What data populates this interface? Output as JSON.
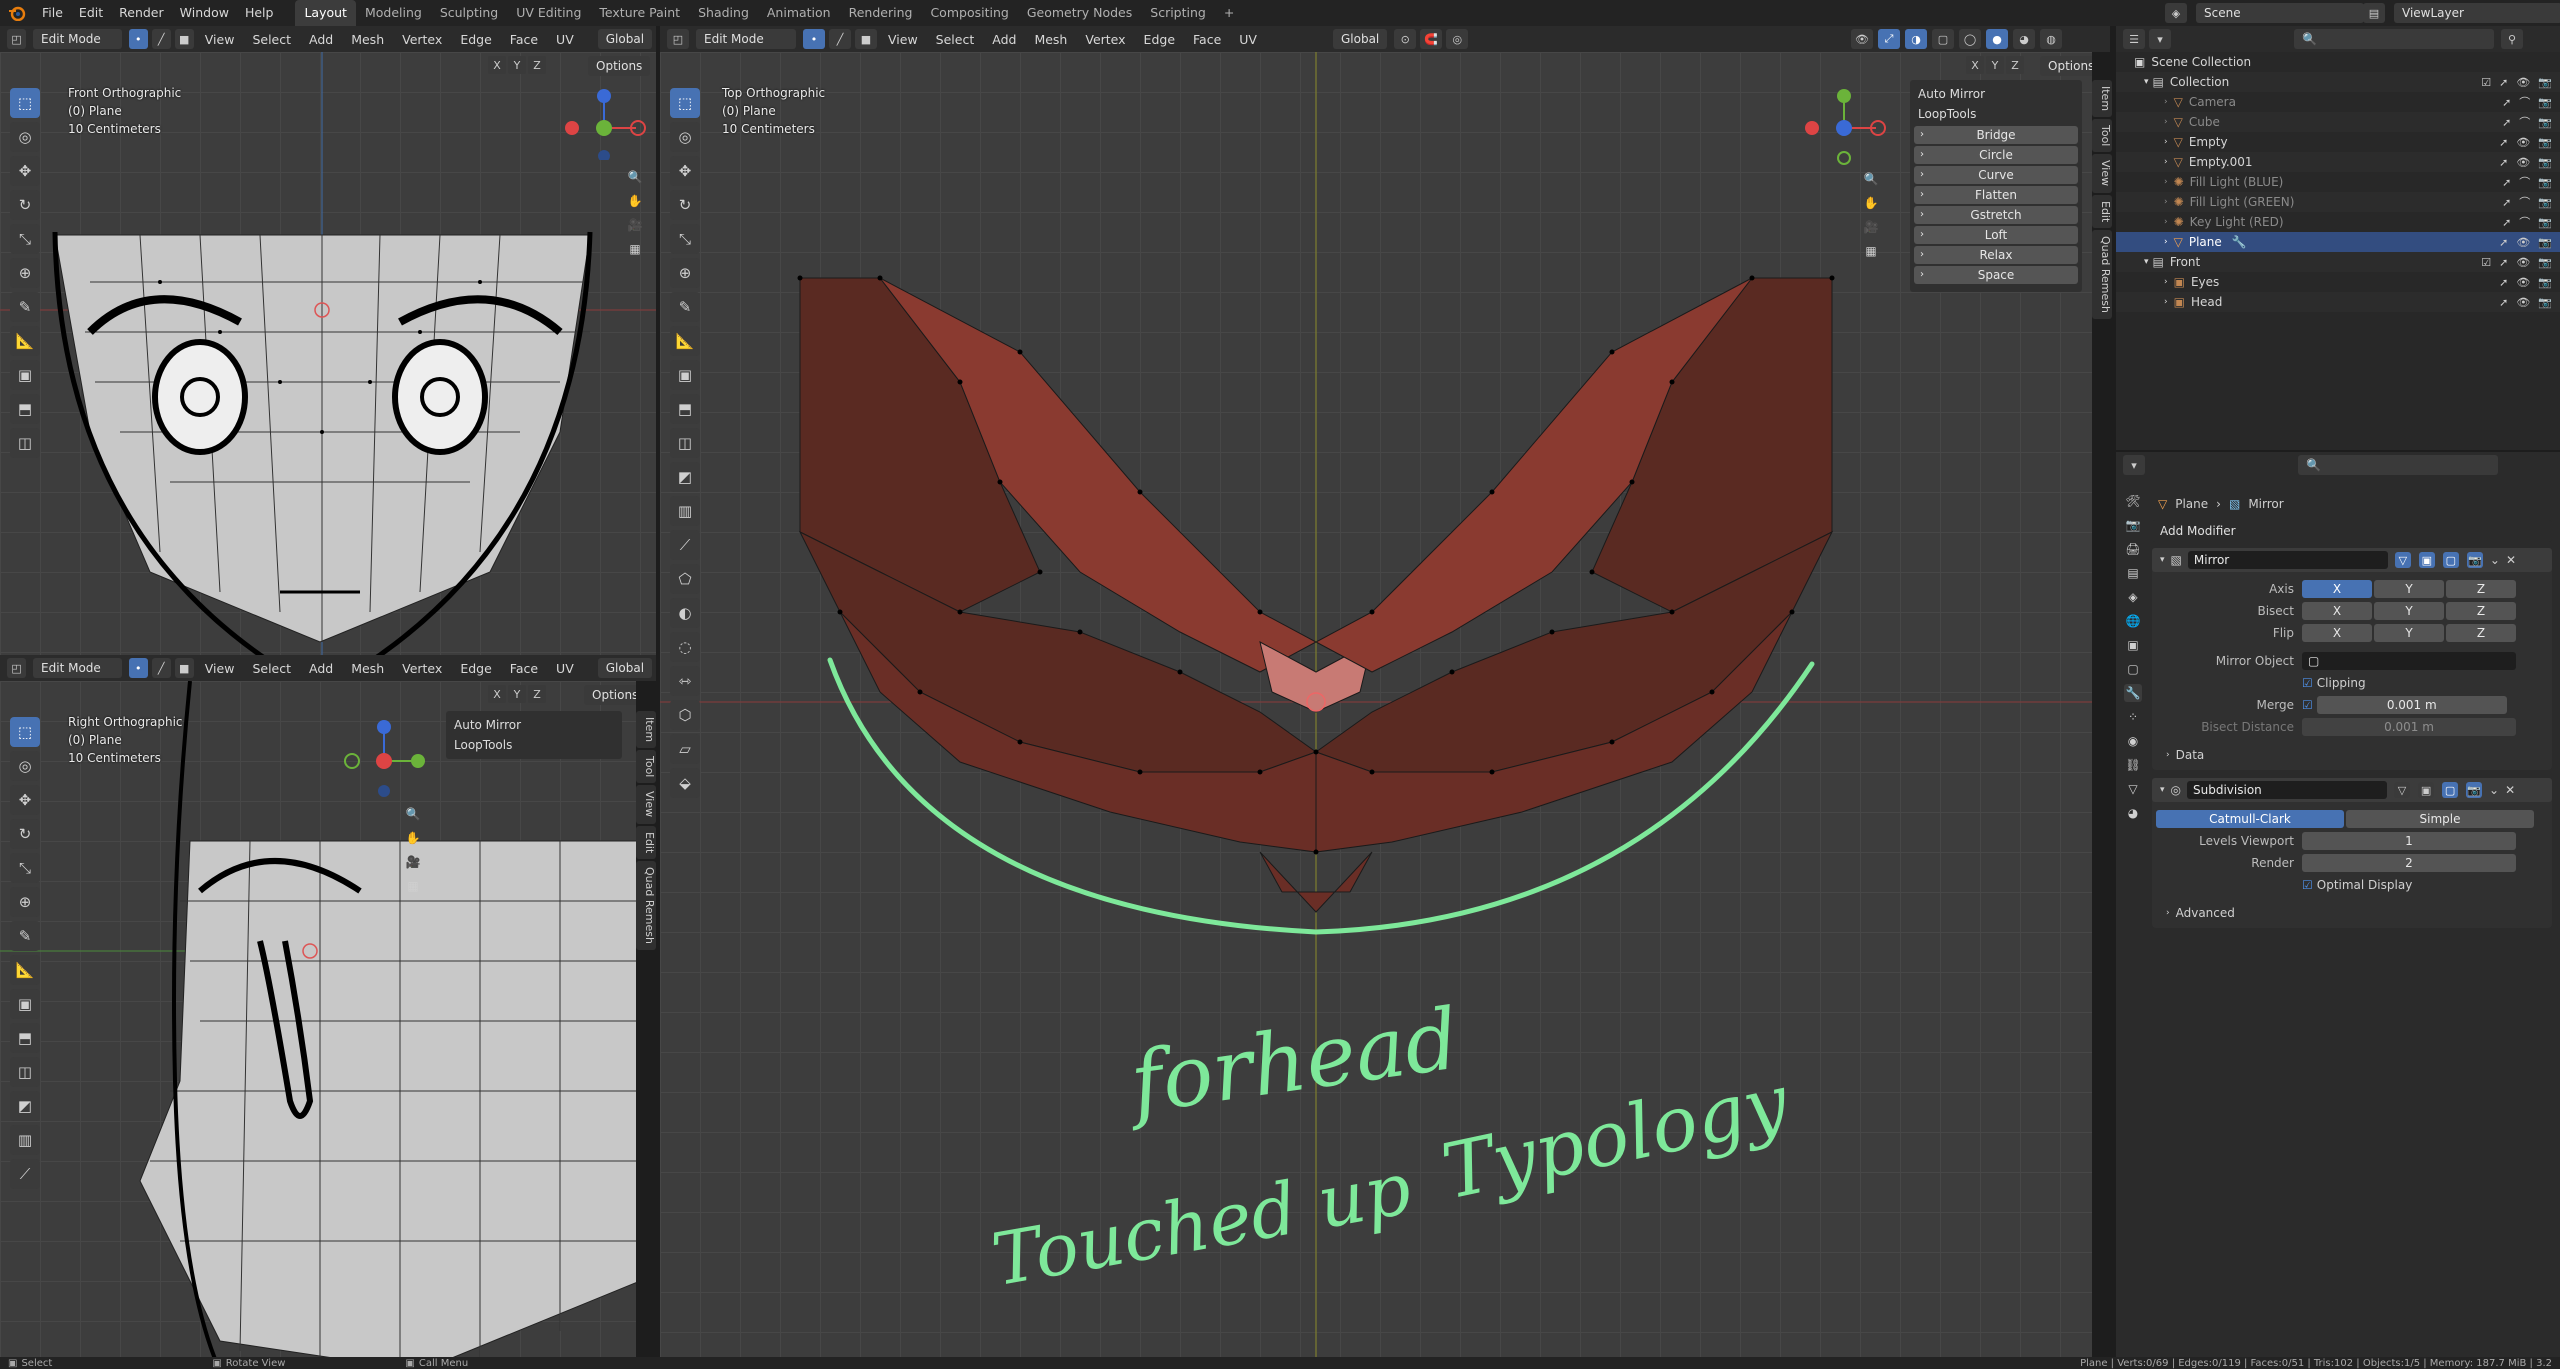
{
  "topbar": {
    "menus": [
      "File",
      "Edit",
      "Render",
      "Window",
      "Help"
    ],
    "workspaces": [
      "Layout",
      "Modeling",
      "Sculpting",
      "UV Editing",
      "Texture Paint",
      "Shading",
      "Animation",
      "Rendering",
      "Compositing",
      "Geometry Nodes",
      "Scripting"
    ],
    "active_workspace": "Layout",
    "add_tab": "+",
    "scene": "Scene",
    "view_layer": "ViewLayer"
  },
  "viewport_left_top": {
    "mode": "Edit Mode",
    "menus": [
      "View",
      "Select",
      "Add",
      "Mesh",
      "Vertex",
      "Edge",
      "Face",
      "UV"
    ],
    "transform": "Global",
    "options": "Options",
    "axes": [
      "X",
      "Y",
      "Z"
    ],
    "info": [
      "Front Orthographic",
      "(0) Plane",
      "10 Centimeters"
    ]
  },
  "viewport_left_bottom": {
    "mode": "Edit Mode",
    "menus": [
      "View",
      "Select",
      "Add",
      "Mesh",
      "Vertex",
      "Edge",
      "Face",
      "UV"
    ],
    "transform": "Global",
    "options": "Options",
    "axes": [
      "X",
      "Y",
      "Z"
    ],
    "info": [
      "Right Orthographic",
      "(0) Plane",
      "10 Centimeters"
    ],
    "panels": [
      "Auto Mirror",
      "LoopTools"
    ],
    "side_tabs": [
      "Item",
      "Tool",
      "View",
      "Edit",
      "Quad Remesh"
    ]
  },
  "viewport_main": {
    "mode": "Edit Mode",
    "menus": [
      "View",
      "Select",
      "Add",
      "Mesh",
      "Vertex",
      "Edge",
      "Face",
      "UV"
    ],
    "transform": "Global",
    "options": "Options",
    "axes": [
      "X",
      "Y",
      "Z"
    ],
    "info": [
      "Top Orthographic",
      "(0) Plane",
      "10 Centimeters"
    ],
    "auto_mirror": "Auto Mirror",
    "looptools": "LoopTools",
    "looptools_buttons": [
      "Bridge",
      "Circle",
      "Curve",
      "Flatten",
      "Gstretch",
      "Loft",
      "Relax",
      "Space"
    ],
    "side_tabs": [
      "Item",
      "Tool",
      "View",
      "Edit",
      "Quad Remesh"
    ],
    "annotation_1": "forhead",
    "annotation_2": "Touched up",
    "annotation_3": "Typology",
    "annotation_color": "#7ee89a"
  },
  "outliner": {
    "root": "Scene Collection",
    "items": [
      {
        "name": "Collection",
        "state": "normal"
      },
      {
        "name": "Camera",
        "state": "dim"
      },
      {
        "name": "Cube",
        "state": "dim"
      },
      {
        "name": "Empty",
        "state": "normal"
      },
      {
        "name": "Empty.001",
        "state": "normal"
      },
      {
        "name": "Fill Light (BLUE)",
        "state": "dim"
      },
      {
        "name": "Fill Light (GREEN)",
        "state": "dim"
      },
      {
        "name": "Key Light (RED)",
        "state": "dim"
      },
      {
        "name": "Plane",
        "state": "selected"
      },
      {
        "name": "Front",
        "state": "normal"
      },
      {
        "name": "Eyes",
        "state": "normal"
      },
      {
        "name": "Head",
        "state": "normal"
      }
    ]
  },
  "properties": {
    "breadcrumb_object": "Plane",
    "breadcrumb_mod": "Mirror",
    "add_modifier": "Add Modifier",
    "mirror": {
      "name": "Mirror",
      "axis_label": "Axis",
      "bisect_label": "Bisect",
      "flip_label": "Flip",
      "xyz": [
        "X",
        "Y",
        "Z"
      ],
      "mirror_object_label": "Mirror Object",
      "clipping_label": "Clipping",
      "merge_label": "Merge",
      "merge_value": "0.001 m",
      "bisect_distance_label": "Bisect Distance",
      "bisect_distance_value": "0.001 m",
      "data_label": "Data"
    },
    "subdivision": {
      "name": "Subdivision",
      "catmull": "Catmull-Clark",
      "simple": "Simple",
      "levels_label": "Levels Viewport",
      "levels_value": "1",
      "render_label": "Render",
      "render_value": "2",
      "optimal_label": "Optimal Display",
      "advanced_label": "Advanced"
    }
  },
  "status": {
    "select": "Select",
    "rotate": "Rotate View",
    "call_menu": "Call Menu",
    "stats": "Plane | Verts:0/69 | Edges:0/119 | Faces:0/51 | Tris:102 | Objects:1/5 | Memory: 187.7 MiB | 3.2"
  }
}
